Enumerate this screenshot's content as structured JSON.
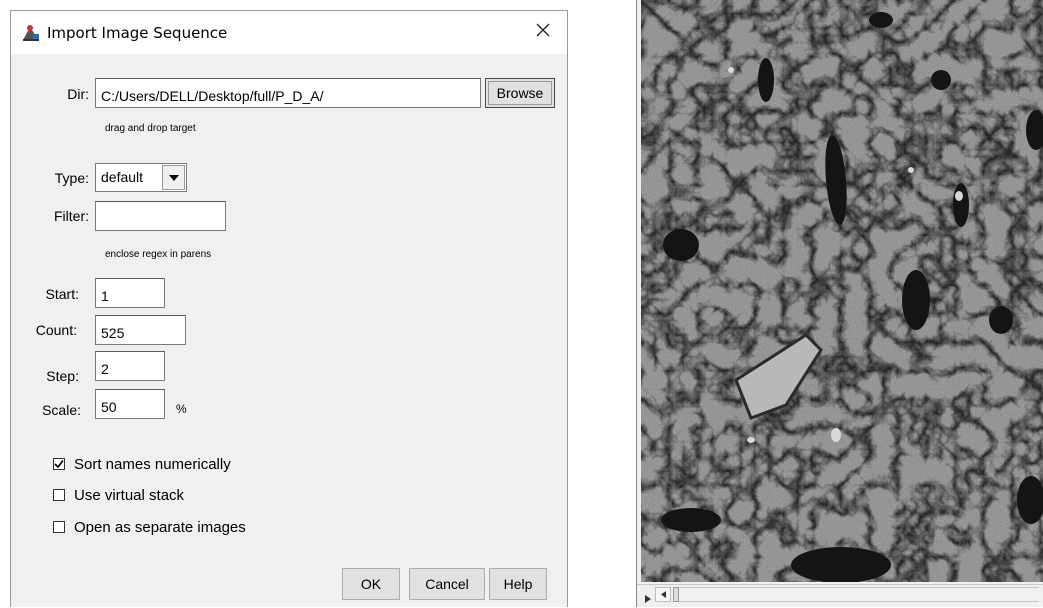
{
  "dialog": {
    "title": "Import Image Sequence",
    "dir_label": "Dir:",
    "dir_value": "C:/Users/DELL/Desktop/full/P_D_A/",
    "browse_label": "Browse",
    "drag_hint": "drag and drop target",
    "type_label": "Type:",
    "type_value": "default",
    "filter_label": "Filter:",
    "filter_value": "",
    "filter_hint": "enclose regex in parens",
    "start_label": "Start:",
    "start_value": "1",
    "count_label": "Count:",
    "count_value": "525",
    "step_label": "Step:",
    "step_value": "2",
    "scale_label": "Scale:",
    "scale_value": "50",
    "scale_unit": "%",
    "options": [
      {
        "label": "Sort names numerically",
        "checked": true
      },
      {
        "label": "Use virtual stack",
        "checked": false
      },
      {
        "label": "Open as separate images",
        "checked": false
      }
    ],
    "buttons": {
      "ok": "OK",
      "cancel": "Cancel",
      "help": "Help"
    }
  },
  "image_window": {
    "description_icon": "microscopy-grayscale-image"
  }
}
